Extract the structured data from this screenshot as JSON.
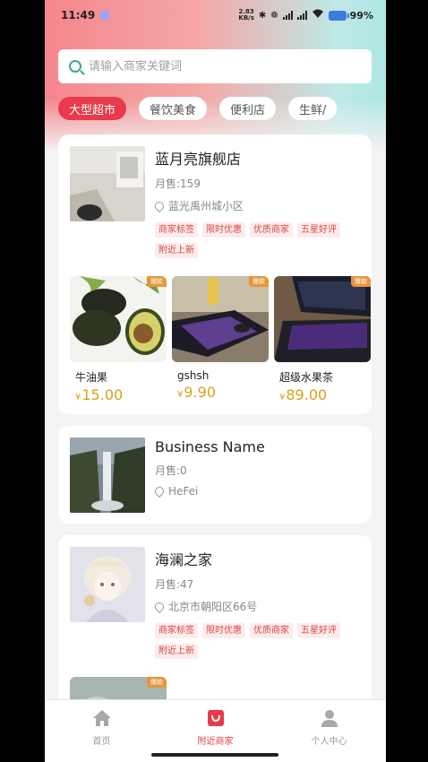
{
  "status_bar": {
    "time": "11:49",
    "net_speed_value": "2.83",
    "net_speed_unit": "KB/s",
    "battery": "99"
  },
  "search": {
    "placeholder": "请输入商家关键词"
  },
  "categories": [
    {
      "label": "大型超市",
      "active": true
    },
    {
      "label": "餐饮美食",
      "active": false
    },
    {
      "label": "便利店",
      "active": false
    },
    {
      "label": "生鲜/",
      "active": false
    }
  ],
  "stores": [
    {
      "name": "蓝月亮旗舰店",
      "sales": "月售:159",
      "address": "蓝光禹州城小区",
      "tags": [
        "商家标签",
        "限时优惠",
        "优质商家",
        "五星好评",
        "附近上新"
      ],
      "products": [
        {
          "name": "牛油果",
          "price": "15.00",
          "badge": "爆款"
        },
        {
          "name": "gshsh",
          "price": "9.90",
          "badge": "爆款"
        },
        {
          "name": "超级水果茶",
          "price": "89.00",
          "badge": "爆款"
        }
      ]
    },
    {
      "name": "Business Name",
      "sales": "月售:0",
      "address": "HeFei"
    },
    {
      "name": "海澜之家",
      "sales": "月售:47",
      "address": "北京市朝阳区66号",
      "tags": [
        "商家标签",
        "限时优惠",
        "优质商家",
        "五星好评",
        "附近上新"
      ],
      "products": [
        {
          "name": "",
          "price": "",
          "badge": "爆款"
        }
      ]
    }
  ],
  "currency_symbol": "¥",
  "tab_bar": {
    "items": [
      {
        "label": "首页",
        "icon": "home-icon",
        "active": false
      },
      {
        "label": "附近商家",
        "icon": "shop-bag-icon",
        "active": true
      },
      {
        "label": "个人中心",
        "icon": "person-icon",
        "active": false
      }
    ]
  },
  "colors": {
    "accent": "#e83a4a",
    "price": "#d6a11e",
    "tag_text": "#d9473f",
    "tag_bg": "#fdecec",
    "search_icon": "#3aa88d"
  }
}
